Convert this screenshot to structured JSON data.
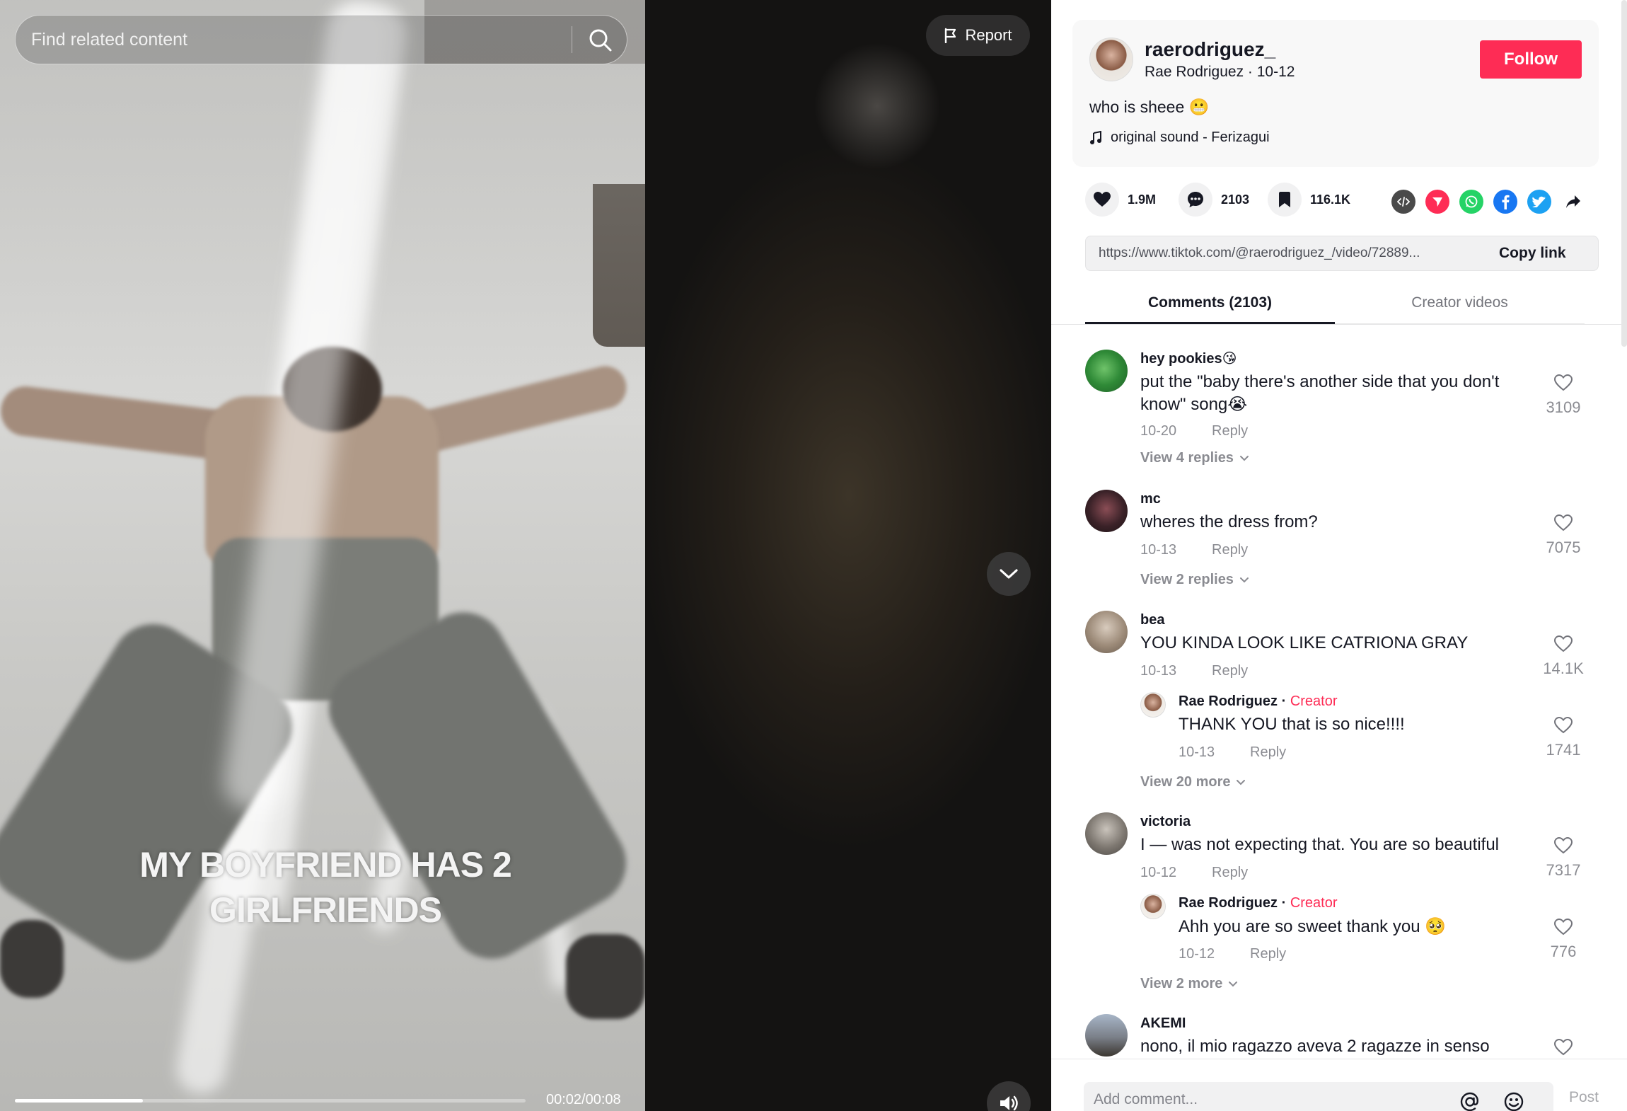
{
  "search": {
    "placeholder": "Find related content"
  },
  "video": {
    "report_label": "Report",
    "caption_line1": "MY BOYFRIEND HAS 2",
    "caption_line2": "GIRLFRIENDS",
    "time": "00:02/00:08",
    "progress_fraction": 0.25
  },
  "author": {
    "username": "raerodriguez_",
    "meta": "Rae Rodriguez · 10-12",
    "follow_label": "Follow",
    "description": "who is sheee 😬",
    "sound": "original sound - Ferizagui"
  },
  "stats": {
    "likes": "1.9M",
    "comments": "2103",
    "saves": "116.1K"
  },
  "share_icons": [
    "embed-icon",
    "send-icon",
    "whatsapp-icon",
    "facebook-icon",
    "twitter-icon",
    "share-arrow-icon"
  ],
  "colors": {
    "accent": "#fe2c55",
    "embed": "#4a4a4a",
    "send": "#fe2c55",
    "whatsapp": "#25d366",
    "facebook": "#1877f2",
    "twitter": "#1da1f2"
  },
  "link": {
    "url": "https://www.tiktok.com/@raerodriguez_/video/72889...",
    "copy_label": "Copy link"
  },
  "tabs": {
    "comments": "Comments (2103)",
    "creator": "Creator videos"
  },
  "comments": [
    {
      "user": "hey pookies😘",
      "text": "put the \"baby there's another side that you don't know\" song😭",
      "date": "10-20",
      "reply": "Reply",
      "likes": "3109",
      "view_more": "View 4 replies"
    },
    {
      "user": "mc",
      "text": "wheres the dress from?",
      "date": "10-13",
      "reply": "Reply",
      "likes": "7075",
      "view_more": "View 2 replies"
    },
    {
      "user": "bea",
      "text": "YOU KINDA LOOK LIKE CATRIONA GRAY",
      "date": "10-13",
      "reply": "Reply",
      "likes": "14.1K",
      "creator_reply": {
        "user": "Rae Rodriguez",
        "badge": "Creator",
        "text": "THANK YOU that is so nice!!!!",
        "date": "10-13",
        "reply": "Reply",
        "likes": "1741"
      },
      "view_more": "View 20 more"
    },
    {
      "user": "victoria",
      "text": "I — was not expecting that. You are so beautiful",
      "date": "10-12",
      "reply": "Reply",
      "likes": "7317",
      "creator_reply": {
        "user": "Rae Rodriguez",
        "badge": "Creator",
        "text": "Ahh you are so sweet thank you 🥺",
        "date": "10-12",
        "reply": "Reply",
        "likes": "776"
      },
      "view_more": "View 2 more"
    },
    {
      "user": "AKEMI",
      "text": "nono, il mio ragazzo aveva 2 ragazze in senso"
    }
  ],
  "footer": {
    "placeholder": "Add comment...",
    "post_label": "Post"
  }
}
